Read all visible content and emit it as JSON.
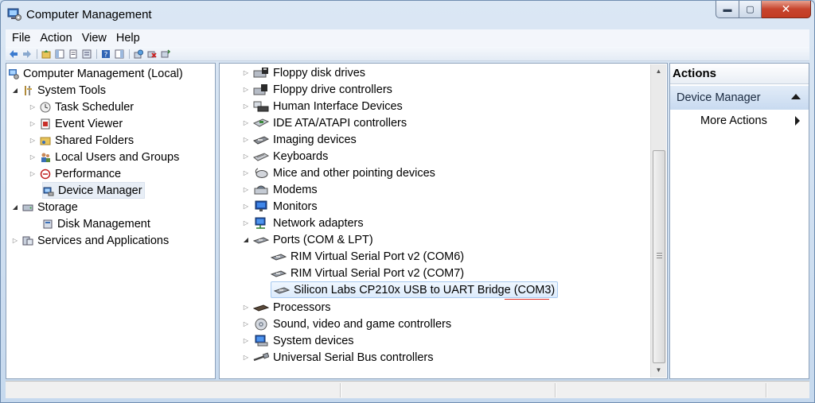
{
  "window": {
    "title": "Computer Management"
  },
  "menu": [
    {
      "label": "File"
    },
    {
      "label": "Action"
    },
    {
      "label": "View"
    },
    {
      "label": "Help"
    }
  ],
  "left_tree": {
    "root": "Computer Management (Local)",
    "system_tools": "System Tools",
    "task_scheduler": "Task Scheduler",
    "event_viewer": "Event Viewer",
    "shared_folders": "Shared Folders",
    "local_users": "Local Users and Groups",
    "performance": "Performance",
    "device_manager": "Device Manager",
    "storage": "Storage",
    "disk_management": "Disk Management",
    "services_apps": "Services and Applications"
  },
  "devices": [
    {
      "label": "Floppy disk drives",
      "icon": "floppy-icon"
    },
    {
      "label": "Floppy drive controllers",
      "icon": "floppy-controller-icon"
    },
    {
      "label": "Human Interface Devices",
      "icon": "hid-icon"
    },
    {
      "label": "IDE ATA/ATAPI controllers",
      "icon": "ide-icon"
    },
    {
      "label": "Imaging devices",
      "icon": "imaging-icon"
    },
    {
      "label": "Keyboards",
      "icon": "keyboard-icon"
    },
    {
      "label": "Mice and other pointing devices",
      "icon": "mouse-icon"
    },
    {
      "label": "Modems",
      "icon": "modem-icon"
    },
    {
      "label": "Monitors",
      "icon": "monitor-icon"
    },
    {
      "label": "Network adapters",
      "icon": "network-icon"
    },
    {
      "label": "Ports (COM & LPT)",
      "icon": "port-icon"
    },
    {
      "label": "RIM Virtual Serial Port v2 (COM6)",
      "icon": "port-icon"
    },
    {
      "label": "RIM Virtual Serial Port v2 (COM7)",
      "icon": "port-icon"
    },
    {
      "label": "Silicon Labs CP210x USB to UART Bridge (COM3)",
      "icon": "port-icon"
    },
    {
      "label": "Processors",
      "icon": "processor-icon"
    },
    {
      "label": "Sound, video and game controllers",
      "icon": "sound-icon"
    },
    {
      "label": "System devices",
      "icon": "system-icon"
    },
    {
      "label": "Universal Serial Bus controllers",
      "icon": "usb-icon"
    }
  ],
  "actions": {
    "header": "Actions",
    "section": "Device Manager",
    "more": "More Actions"
  },
  "colors": {
    "selection_border": "#a8caf0",
    "close_button": "#c7442d"
  }
}
